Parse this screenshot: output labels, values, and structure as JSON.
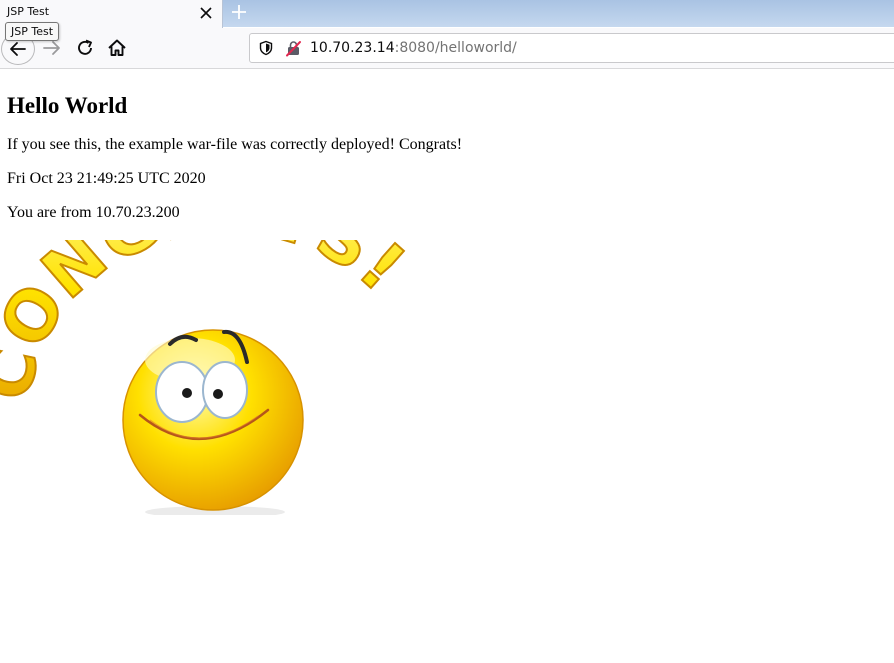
{
  "browser": {
    "tab_title": "JSP Test",
    "tooltip": "JSP Test",
    "url_host": "10.70.23.14",
    "url_rest": ":8080/helloworld/"
  },
  "page": {
    "heading": "Hello World",
    "line1": "If you see this, the example war-file was correctly deployed! Congrats!",
    "line2": "Fri Oct 23 21:49:25 UTC 2020",
    "line3": "You are from 10.70.23.200",
    "image_text": "CONGRATS!"
  },
  "colors": {
    "tabbar": "#bcd0ea",
    "congrats_yellow": "#ffe000",
    "smiley_yellow": "#ffd700"
  },
  "icons": {
    "back": "back-arrow-icon",
    "forward": "forward-arrow-icon",
    "reload": "reload-icon",
    "home": "home-icon",
    "shield": "shield-icon",
    "insecure": "insecure-lock-icon",
    "close": "close-icon",
    "new_tab": "plus-icon"
  }
}
